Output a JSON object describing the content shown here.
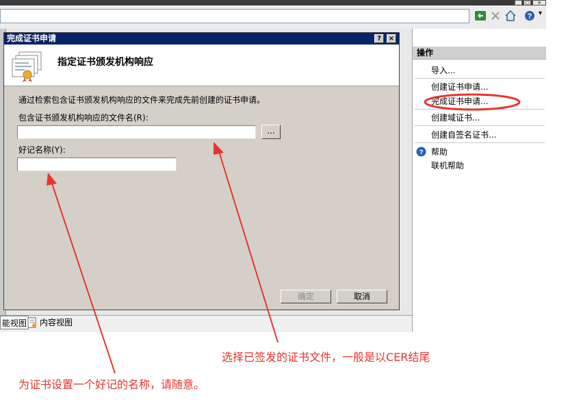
{
  "window": {
    "bottom_tabs": [
      "能视图",
      "内容视图"
    ]
  },
  "dialog": {
    "title": "完成证书申请",
    "help_button": "?",
    "close_button": "×",
    "heading": "指定证书颁发机构响应",
    "description": "通过检索包含证书颁发机构响应的文件来完成先前创建的证书申请。",
    "file_label": "包含证书颁发机构响应的文件名(R):",
    "file_value": "",
    "browse_label": "...",
    "friendly_label": "好记名称(Y):",
    "friendly_value": "",
    "ok_label": "确定",
    "cancel_label": "取消"
  },
  "actions": {
    "header": "操作",
    "items": [
      "导入...",
      "创建证书申请...",
      "完成证书申请...",
      "创建域证书...",
      "创建自签名证书..."
    ],
    "help": "帮助",
    "online_help": "联机帮助"
  },
  "annotations": {
    "file_note": "选择已签发的证书文件，一般是以CER结尾",
    "name_note": "为证书设置一个好记的名称，请随意。"
  },
  "colors": {
    "annotation": "#e8342e",
    "dialog_title_bg": "#0a246a"
  }
}
